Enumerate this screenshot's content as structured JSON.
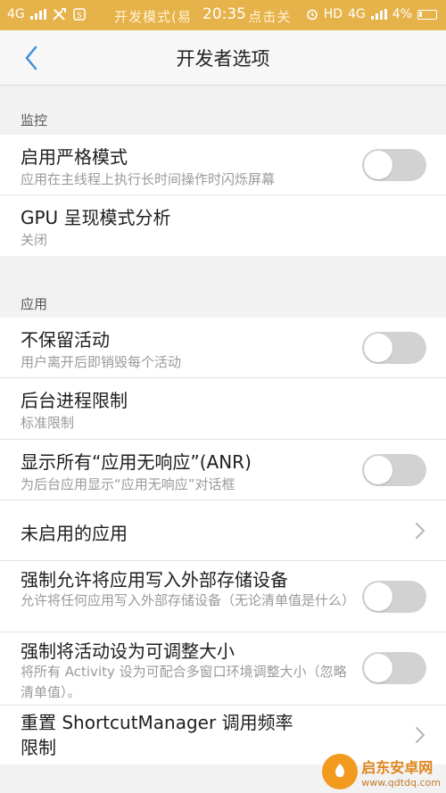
{
  "status_bar": {
    "network": "4G",
    "notice": "开发模式(易",
    "notice_tail": "点击关",
    "time": "20:35",
    "hd": "HD",
    "network_right": "4G",
    "battery": "4%",
    "color": "#e6b24a"
  },
  "header": {
    "back_icon": "chevron-left-icon",
    "title": "开发者选项"
  },
  "sections": {
    "monitor": {
      "label": "监控",
      "items": [
        {
          "title": "启用严格模式",
          "subtitle": "应用在主线程上执行长时间操作时闪烁屏幕",
          "control": "toggle",
          "on": false
        },
        {
          "title": "GPU 呈现模式分析",
          "subtitle": "关闭",
          "control": "none"
        }
      ]
    },
    "apps": {
      "label": "应用",
      "items": [
        {
          "title": "不保留活动",
          "subtitle": "用户离开后即销毁每个活动",
          "control": "toggle",
          "on": false
        },
        {
          "title": "后台进程限制",
          "subtitle": "标准限制",
          "control": "none"
        },
        {
          "title": "显示所有“应用无响应”(ANR)",
          "subtitle": "为后台应用显示“应用无响应”对话框",
          "control": "toggle",
          "on": false
        },
        {
          "title": "未启用的应用",
          "subtitle": "",
          "control": "chevron"
        },
        {
          "title": "强制允许将应用写入外部存储设备",
          "subtitle": "允许将任何应用写入外部存储设备（无论清单值是什么）",
          "control": "toggle",
          "on": false
        },
        {
          "title": "强制将活动设为可调整大小",
          "subtitle": "将所有 Activity 设为可配合多窗口环境调整大小（忽略清单值）。",
          "control": "toggle",
          "on": false
        },
        {
          "title": "重置 ShortcutManager 调用频率限制",
          "subtitle": "",
          "control": "chevron"
        }
      ]
    }
  },
  "watermark": {
    "name": "启东安卓网",
    "url": "www.qdtdq.com"
  },
  "colors": {
    "toggle_off": "#d2d2d2",
    "accent": "#3b8fd6"
  }
}
